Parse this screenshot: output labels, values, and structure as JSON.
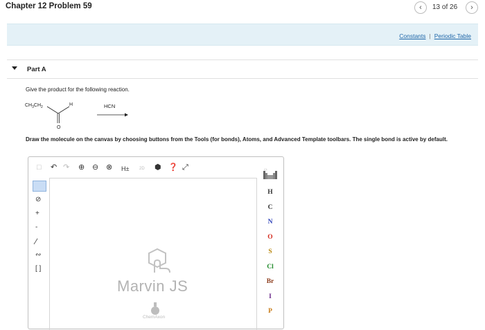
{
  "header": {
    "title": "Chapter 12 Problem 59",
    "prev_icon": "chevron-left-icon",
    "next_icon": "chevron-right-icon",
    "pager": "13 of 26"
  },
  "links": {
    "constants": "Constants",
    "separator": "|",
    "periodic_table": "Periodic Table",
    "color": "#1e66a8"
  },
  "part": {
    "label": "Part A",
    "question": "Give the product for the following reaction.",
    "reactant_left": "CH3CH2",
    "reactant_h": "H",
    "reactant_o": "O",
    "reagent": "HCN",
    "instructions": "Draw the molecule on the canvas by choosing buttons from the Tools (for bonds), Atoms, and Advanced Template toolbars. The single bond is active by default."
  },
  "editor": {
    "toolbar_icons": [
      "new-document-icon",
      "undo-icon",
      "redo-icon",
      "zoom-in-icon",
      "zoom-out-icon",
      "zoom-reset-icon",
      "explicit-h-icon",
      "2d-clean-icon",
      "info-icon",
      "help-icon",
      "fullscreen-icon"
    ],
    "hs_label": "H±",
    "d2_label": "2D",
    "left_tool_icons": [
      "rectangle-select-icon",
      "eraser-icon",
      "increase-charge-icon",
      "decrease-charge-icon",
      "single-bond-icon",
      "chain-icon",
      "bracket-icon"
    ],
    "plus_label": "+",
    "minus_label": "-",
    "watermark": "Marvin JS",
    "brand": "ChemAxon",
    "periodic_icon": "periodic-table-icon",
    "atoms": [
      {
        "symbol": "H",
        "color": "#333333"
      },
      {
        "symbol": "C",
        "color": "#333333"
      },
      {
        "symbol": "N",
        "color": "#2b3fb8"
      },
      {
        "symbol": "O",
        "color": "#d42a1d"
      },
      {
        "symbol": "S",
        "color": "#b8860b"
      },
      {
        "symbol": "Cl",
        "color": "#1f8a2a"
      },
      {
        "symbol": "Br",
        "color": "#8b3a1a"
      },
      {
        "symbol": "I",
        "color": "#6a2a8a"
      },
      {
        "symbol": "P",
        "color": "#c87a14"
      }
    ]
  }
}
